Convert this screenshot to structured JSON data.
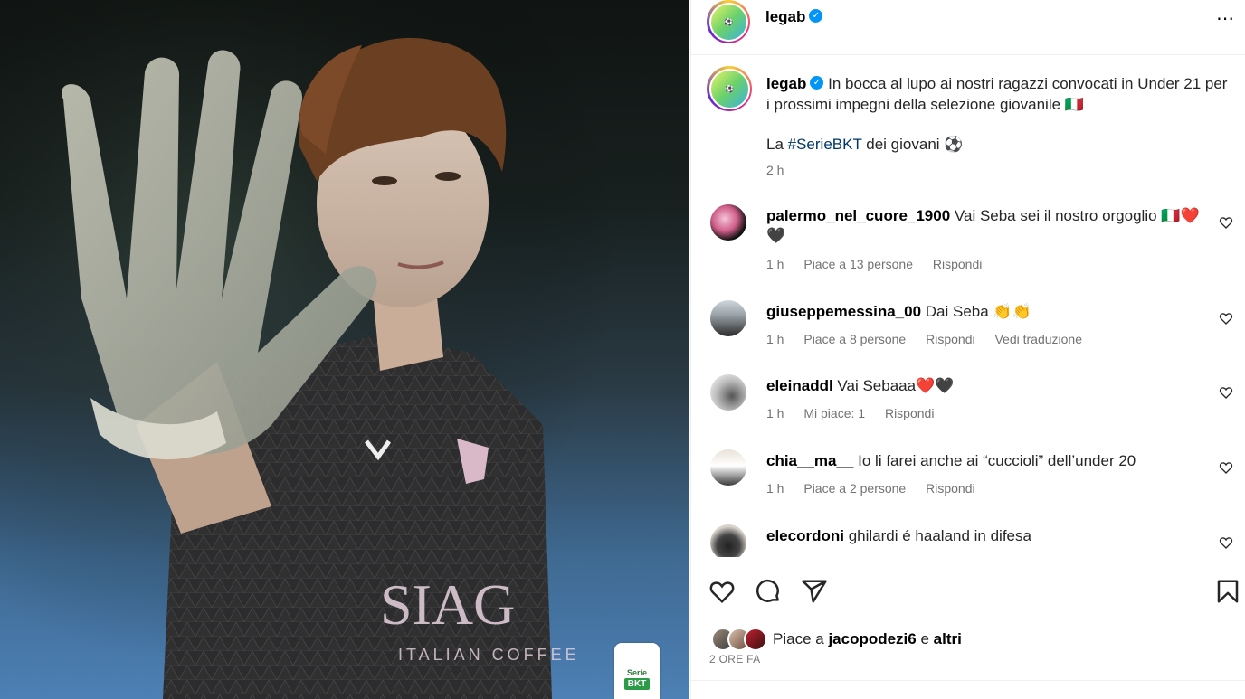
{
  "post": {
    "username": "legab",
    "more_icon": "⋯"
  },
  "caption": {
    "username": "legab",
    "line1": "In bocca al lupo ai nostri ragazzi convocati in Under 21 per i prossimi impegni della selezione giovanile 🇮🇹",
    "line2_prefix": "La ",
    "hashtag": "#SerieBKT",
    "line2_suffix": " dei giovani ⚽",
    "time": "2 h"
  },
  "comments": [
    {
      "username": "palermo_nel_cuore_1900",
      "text": "Vai Seba sei il nostro orgoglio 🇮🇹❤️🖤",
      "time": "1 h",
      "likes": "Piace a 13 persone",
      "reply": "Rispondi",
      "translate": ""
    },
    {
      "username": "giuseppemessina_00",
      "text": "Dai Seba 👏👏",
      "time": "1 h",
      "likes": "Piace a 8 persone",
      "reply": "Rispondi",
      "translate": "Vedi traduzione"
    },
    {
      "username": "eleinaddl",
      "text": "Vai Sebaaa❤️🖤",
      "time": "1 h",
      "likes": "Mi piace: 1",
      "reply": "Rispondi",
      "translate": ""
    },
    {
      "username": "chia__ma__",
      "text": "Io li farei anche ai “cuccioli” dell’under 20",
      "time": "1 h",
      "likes": "Piace a 2 persone",
      "reply": "Rispondi",
      "translate": ""
    },
    {
      "username": "elecordoni",
      "text": "ghilardi é haaland in difesa",
      "time": "",
      "likes": "",
      "reply": "",
      "translate": ""
    }
  ],
  "likes_bar": {
    "prefix": "Piace a ",
    "user": "jacopodezi6",
    "middle": " e ",
    "others": "altri",
    "date": "2 ORE FA"
  },
  "badge": {
    "serie": "Serie",
    "bkt": "BKT"
  },
  "colors": {
    "accent_blue": "#0095f6",
    "hashtag": "#00376b",
    "muted": "#737373"
  }
}
